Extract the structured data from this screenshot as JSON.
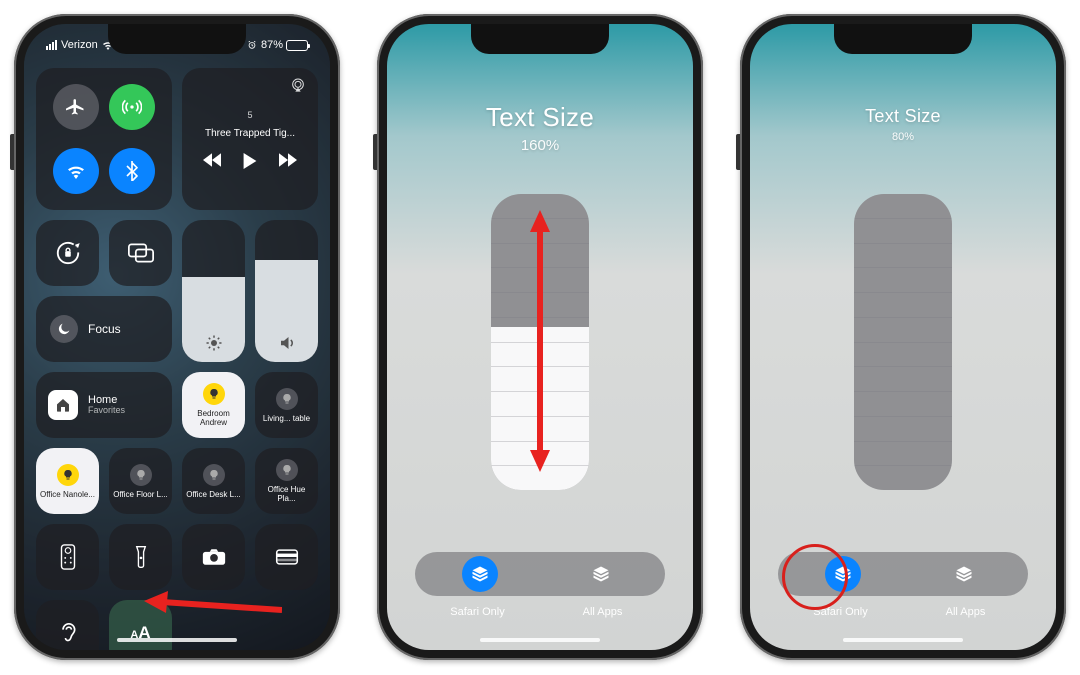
{
  "phone1": {
    "status": {
      "carrier": "Verizon",
      "battery_pct": "87%",
      "battery_fill_pct": 87
    },
    "connectivity": {
      "airplane": "airplane-icon",
      "cellular": "antenna-icon",
      "wifi": "wifi-icon",
      "bluetooth": "bluetooth-icon"
    },
    "music": {
      "line1": "5",
      "line2": "Three Trapped Tig..."
    },
    "focus_label": "Focus",
    "brightness_fill_pct": 60,
    "volume_fill_pct": 72,
    "home": {
      "title": "Home",
      "subtitle": "Favorites"
    },
    "devices": {
      "bedroom": "Bedroom Andrew",
      "living": "Living... table",
      "office_nano": "Office Nanole...",
      "office_floor": "Office Floor L...",
      "office_desk": "Office Desk L...",
      "office_hue": "Office Hue Pla..."
    },
    "text_size_label": "AA"
  },
  "phone2": {
    "title": "Text Size",
    "percent": "160%",
    "slider_fill_pct": 55,
    "segments": {
      "left": "Safari Only",
      "right": "All Apps",
      "active": "left"
    }
  },
  "phone3": {
    "title": "Text Size",
    "percent": "80%",
    "slider_fill_pct": 0,
    "segments": {
      "left": "Safari Only",
      "right": "All Apps",
      "active": "left"
    }
  }
}
